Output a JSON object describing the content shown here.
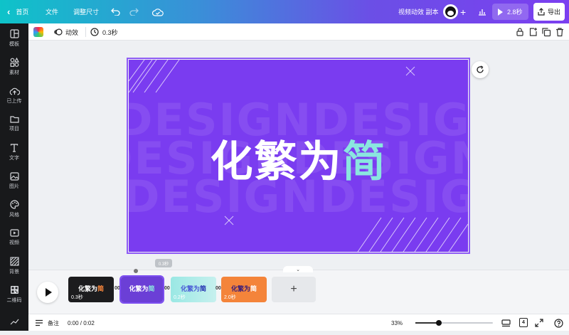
{
  "topbar": {
    "home_label": "首页",
    "file_label": "文件",
    "resize_label": "调整尺寸",
    "doc_name": "视频动效 副本",
    "play_duration": "2.8秒",
    "export_label": "导出",
    "colors": {
      "gradient_start": "#0ec3c9",
      "gradient_end": "#7b3ff0"
    }
  },
  "sidebar": {
    "items": [
      {
        "label": "模板",
        "icon": "template-icon"
      },
      {
        "label": "素材",
        "icon": "elements-icon"
      },
      {
        "label": "已上传",
        "icon": "upload-icon"
      },
      {
        "label": "项目",
        "icon": "folder-icon"
      },
      {
        "label": "文字",
        "icon": "text-icon"
      },
      {
        "label": "图片",
        "icon": "image-icon"
      },
      {
        "label": "风格",
        "icon": "palette-icon"
      },
      {
        "label": "视频",
        "icon": "video-icon"
      },
      {
        "label": "背景",
        "icon": "background-icon"
      },
      {
        "label": "二维码",
        "icon": "qrcode-icon"
      }
    ]
  },
  "context_toolbar": {
    "animate_label": "动效",
    "duration_label": "0.3秒"
  },
  "slide": {
    "background_words": "DESIGNDESIGN",
    "headline_main": "化繁为",
    "headline_accent": "简",
    "colors": {
      "background": "#7a3cf0",
      "accent": "#8ae6df"
    }
  },
  "timeline": {
    "tooltip": "0.3秒",
    "transition_label": "00",
    "clips": [
      {
        "title_main": "化繁为",
        "title_accent": "简",
        "duration": "0.3秒"
      },
      {
        "title_main": "化繁为",
        "title_accent": "简",
        "duration": ""
      },
      {
        "title_main": "化繁为",
        "title_accent": "简",
        "duration": "0.2秒"
      },
      {
        "title_main": "化繁为",
        "title_accent": "简",
        "duration": "2.0秒"
      }
    ],
    "add_label": "+"
  },
  "footer": {
    "notes_label": "备注",
    "time_display": "0:00 / 0:02",
    "zoom_level": "33%",
    "zoom_fraction": 0.3,
    "page_count": "4"
  }
}
